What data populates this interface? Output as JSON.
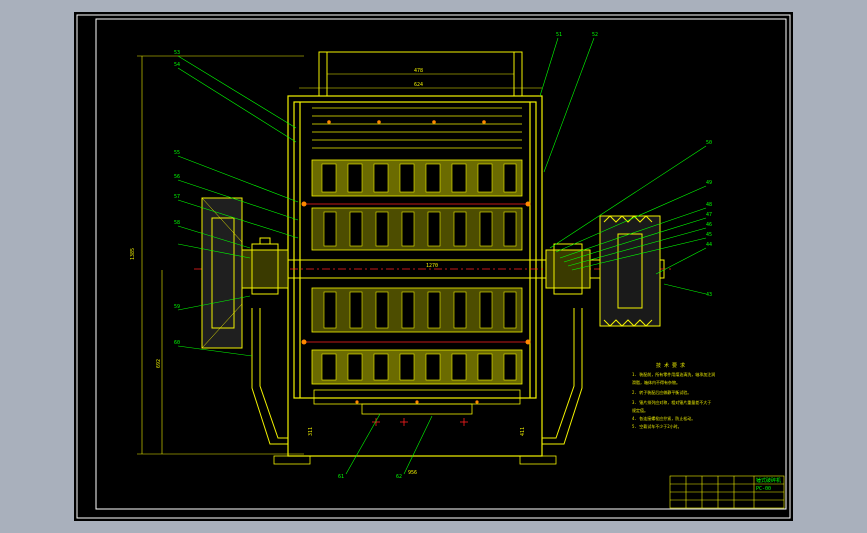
{
  "drawing": {
    "background": "#000000",
    "frame_color": "#ffffff",
    "outline_color": "#f2f200",
    "hatch_color": "#c8c800",
    "body_color": "#ffff00",
    "leader_color": "#00ff00",
    "centerline_color": "#ff2020"
  },
  "labels": {
    "top_dim_inner": "478",
    "top_dim_outer": "624",
    "shaft_dim": "1270",
    "bottom_dim": "956",
    "left_height": "1385",
    "left_lower": "692",
    "right_low_a": "311",
    "right_low_b": "411",
    "callouts_left": [
      "53",
      "54",
      "55",
      "56",
      "57",
      "58",
      "59",
      "60"
    ],
    "callouts_right": [
      "51",
      "52",
      "50",
      "49",
      "48",
      "47",
      "46",
      "45",
      "44",
      "43"
    ],
    "callouts_bottom": [
      "61",
      "62"
    ]
  },
  "notes": {
    "title": "技 术 要 求",
    "lines": [
      "1. 装配前，所有零件用煤油清洗，轴承加注润",
      "   滑脂，箱体内不得有杂物。",
      "2. 转子装配后应做静平衡试验。",
      "3. 锤片排列应对称，相对锤片重量差不大于",
      "   规定值。",
      "4. 各连接螺栓应拧紧，防止松动。",
      "5. 空载试车不少于2小时。"
    ]
  },
  "title_block": {
    "name": "锤式破碎机",
    "code": "PC-00"
  }
}
